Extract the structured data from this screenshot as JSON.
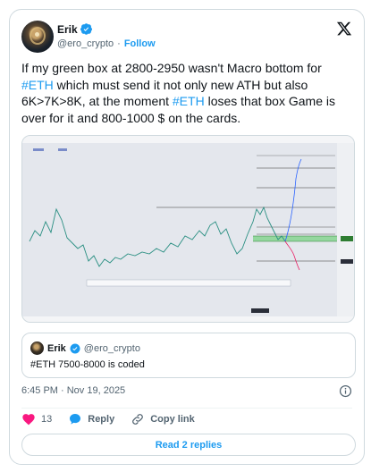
{
  "author": {
    "name": "Erik",
    "handle": "@ero_crypto",
    "separator": "·",
    "follow_label": "Follow",
    "avatar_icon": "avatar-image",
    "verified_icon": "verified-badge-icon"
  },
  "tweet": {
    "parts": [
      {
        "text": "If my green box at 2800-2950 wasn't Macro bottom for ",
        "tag": false
      },
      {
        "text": "#ETH",
        "tag": true
      },
      {
        "text": " which must send it not only new ATH but also 6K>7K>8K, at the moment ",
        "tag": false
      },
      {
        "text": "#ETH",
        "tag": true
      },
      {
        "text": " loses that box Game is over for it and 800-1000 $ on the cards.",
        "tag": false
      }
    ]
  },
  "chart_image": {
    "description_icon": "tradingview-chart-screenshot",
    "colors": {
      "up": "#26a69a",
      "down": "#111111",
      "projection_up": "#2962ff",
      "projection_down": "#e91e63",
      "box": "#4caf50"
    }
  },
  "quote": {
    "name": "Erik",
    "handle": "@ero_crypto",
    "text": "#ETH 7500-8000 is coded"
  },
  "meta": {
    "timestamp": "6:45 PM · Nov 19, 2025"
  },
  "actions": {
    "likes_count": "13",
    "reply_label": "Reply",
    "copy_link_label": "Copy link"
  },
  "replies_button": "Read 2 replies",
  "colors": {
    "accent": "#1d9bf0",
    "like": "#f91880",
    "text": "#0f1419",
    "muted": "#536471",
    "border": "#cfd9de"
  }
}
